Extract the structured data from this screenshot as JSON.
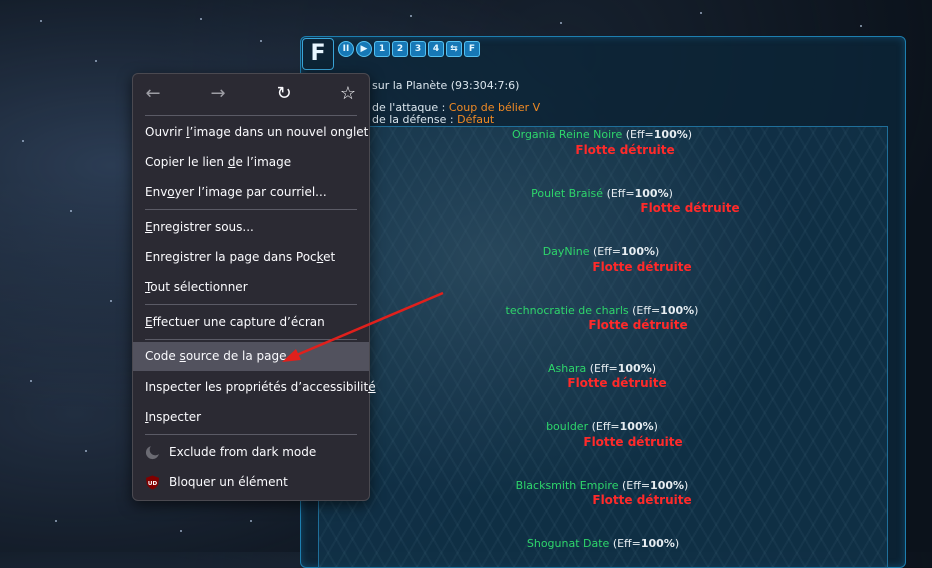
{
  "game": {
    "logo": "F",
    "controls": [
      "II",
      "▶",
      "1",
      "2",
      "3",
      "4",
      "⇆",
      "F"
    ],
    "battle_title": "sur la Planète (93:304:7:6)",
    "attack_label": "de l'attaque :",
    "attack_value": "Coup de bélier V",
    "defense_label": "de la défense :",
    "defense_value": "Défaut",
    "players": [
      {
        "name": "Organia Reine Noire",
        "eff": "(Eff=",
        "pct": "100%",
        "close": ")",
        "status": "Flotte détruite"
      },
      {
        "name": "Poulet Braisé",
        "eff": "(Eff=",
        "pct": "100%",
        "close": ")",
        "status": "Flotte détruite"
      },
      {
        "name": "DayNine",
        "eff": "(Eff=",
        "pct": "100%",
        "close": ")",
        "status": "Flotte détruite"
      },
      {
        "name": "technocratie de charls",
        "eff": "(Eff=",
        "pct": "100%",
        "close": ")",
        "status": "Flotte détruite"
      },
      {
        "name": "Ashara",
        "eff": "(Eff=",
        "pct": "100%",
        "close": ")",
        "status": "Flotte détruite"
      },
      {
        "name": "boulder",
        "eff": "(Eff=",
        "pct": "100%",
        "close": ")",
        "status": "Flotte détruite"
      },
      {
        "name": "Blacksmith Empire",
        "eff": "(Eff=",
        "pct": "100%",
        "close": ")",
        "status": "Flotte détruite"
      },
      {
        "name": "Shogunat Date",
        "eff": "(Eff=",
        "pct": "100%",
        "close": ")",
        "status": ""
      }
    ]
  },
  "context_menu": {
    "nav": {
      "back": "←",
      "forward": "→",
      "reload": "↻",
      "bookmark": "☆"
    },
    "items": [
      {
        "pre": "Ouvrir ",
        "u": "l",
        "post": "’image dans un nouvel onglet"
      },
      {
        "pre": "Copier le lien ",
        "u": "d",
        "post": "e l’image"
      },
      {
        "pre": "Env",
        "u": "o",
        "post": "yer l’image par courriel..."
      },
      {
        "pre": "",
        "u": "E",
        "post": "nregistrer sous..."
      },
      {
        "pre": "Enregistrer la page dans Poc",
        "u": "k",
        "post": "et"
      },
      {
        "pre": "",
        "u": "T",
        "post": "out sélectionner"
      },
      {
        "pre": "",
        "u": "E",
        "post": "ffectuer une capture d’écran"
      },
      {
        "pre": "Code ",
        "u": "s",
        "post": "ource de la page"
      },
      {
        "pre": "Inspecter les propriétés d’accessibilit",
        "u": "é",
        "post": ""
      },
      {
        "pre": "",
        "u": "I",
        "post": "nspecter"
      },
      {
        "pre": "Exclude from dark mode",
        "u": "",
        "post": ""
      },
      {
        "pre": "Bloquer un élément",
        "u": "",
        "post": ""
      }
    ],
    "ublock_badge": "UD"
  },
  "colors": {
    "menu_bg": "#2b2a33",
    "menu_highlight": "#52525e",
    "player_name": "#2ed66b",
    "destroyed": "#ff2a2a",
    "accent_orange": "#f08a24",
    "arrow_red": "#e0201c"
  }
}
